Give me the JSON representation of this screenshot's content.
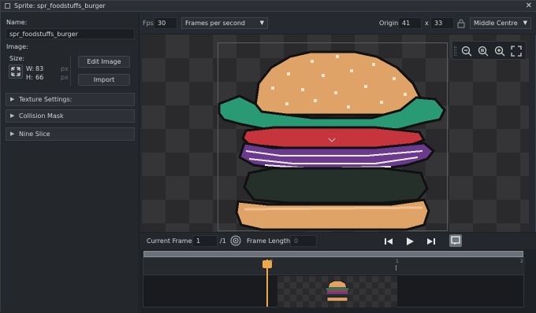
{
  "window": {
    "title": "Sprite: spr_foodstuffs_burger",
    "close_glyph": "✕"
  },
  "left": {
    "name_label": "Name:",
    "name_value": "spr_foodstuffs_burger",
    "image_label": "Image:",
    "size_label": "Size:",
    "width_label": "W:",
    "width_value": "83",
    "height_label": "H:",
    "height_value": "66",
    "unit_px": "px",
    "edit_image": "Edit Image",
    "import": "Import",
    "sections": [
      {
        "label": "Texture Settings:"
      },
      {
        "label": "Collision Mask"
      },
      {
        "label": "Nine Slice"
      }
    ]
  },
  "topbar": {
    "fps_label": "Fps",
    "fps_value": "30",
    "fps_mode": "Frames per second",
    "origin_label": "Origin",
    "origin_x": "41",
    "origin_sep": "x",
    "origin_y": "33",
    "origin_preset": "Middle Centre"
  },
  "frames": {
    "current_label": "Current Frame:",
    "current_value": "1",
    "total": "/1",
    "length_label": "Frame Length:",
    "length_value": "0"
  },
  "timeline": {
    "tick_0": "0",
    "tick_1": "1",
    "tick_end": "2"
  },
  "icons": {
    "zoom_out": "zoom-out-icon",
    "zoom_reset": "zoom-reset-icon",
    "zoom_in": "zoom-in-icon",
    "fullscreen": "fullscreen-icon",
    "lock": "lock-icon",
    "prev": "skip-back-icon",
    "play": "play-icon",
    "next": "skip-forward-icon"
  },
  "colors": {
    "bun": "#e0a367",
    "lettuce": "#2a9a74",
    "tomato": "#c6343c",
    "onion": "#6a3a8e",
    "patty": "#25302a",
    "playhead": "#f0a64a"
  }
}
